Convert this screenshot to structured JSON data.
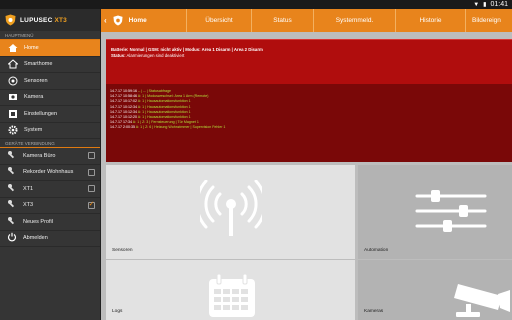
{
  "status_bar": {
    "time": "01:41"
  },
  "app": {
    "title_main": "LUPUSEC ",
    "title_accent": "XT3"
  },
  "sidebar": {
    "main_section": "HAUPTMENÜ",
    "items": [
      {
        "label": "Home",
        "icon": "home-icon",
        "active": true
      },
      {
        "label": "Smarthome",
        "icon": "home-outline-icon"
      },
      {
        "label": "Sensoren",
        "icon": "sensors-icon"
      },
      {
        "label": "Kamera",
        "icon": "camera-icon"
      },
      {
        "label": "Einstellungen",
        "icon": "settings-icon"
      },
      {
        "label": "System",
        "icon": "gear-icon"
      }
    ],
    "devices_section": "GERÄTE VERBINDUNG",
    "devices": [
      {
        "label": "Kamera Büro",
        "checked": false
      },
      {
        "label": "Rekorder Wohnhaus",
        "checked": false
      },
      {
        "label": "XT1",
        "checked": false
      },
      {
        "label": "XT3",
        "checked": true
      }
    ],
    "new_profile": "Neues Profil",
    "logout": "Abmelden"
  },
  "tabs": [
    "Home",
    "Übersicht",
    "Status",
    "Systemmeld.",
    "Historie",
    "Bildereign"
  ],
  "alarm": {
    "line1_label_battery": "Batterie:",
    "line1_text": " Normal | GSM: nicht aktiv | Modus: Area 1 Disarm | Area 2 Disarm",
    "line2_label": "Status:",
    "line2_text": " Alarmierungen sind deaktiviert"
  },
  "log": [
    {
      "ts": "14.7.17 10:59:16 ",
      "msg": "-- | -- | Statusabfrage"
    },
    {
      "ts": "14.7.17 10:58:46 ",
      "msg": "A: 1 | Modusweschsel: Area 1 Arm (Remote)"
    },
    {
      "ts": "14.7.17 10:17:02 ",
      "msg": "A: 1 | Hausautomationsfunktion 1"
    },
    {
      "ts": "14.7.17 10:12:34 ",
      "msg": "A: 1 | Hausautomationsfunktion 1"
    },
    {
      "ts": "14.7.17 10:12:34 ",
      "msg": "A: 1 | Hausautomationsfunktion 1"
    },
    {
      "ts": "14.7.17 10:12:20 ",
      "msg": "A: 1 | Hausautomationsfunktion 1"
    },
    {
      "ts": "14.7.17 17:34 ",
      "msg": "A: 1 | Z: 3 | Fernsteuerung | Tür Magnet 1"
    },
    {
      "ts": "14.7.17 2:00:35 ",
      "msg": "A: 1 | Z: 6 | Heizung Wohnzimmer | Supervision Fehler 1"
    }
  ],
  "tiles": {
    "sensoren": "Sensoren",
    "automation": "Automation",
    "logs": "Logs",
    "kameras": "Kameras"
  },
  "colors": {
    "accent": "#e8841c",
    "alarm": "#b00d0d",
    "log_green": "#b4e13a"
  }
}
